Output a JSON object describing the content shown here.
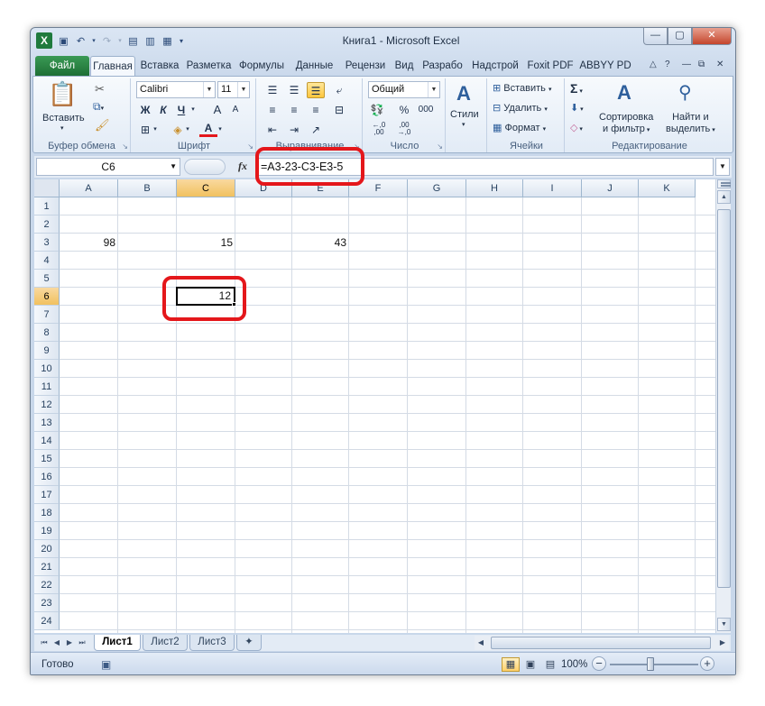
{
  "window": {
    "title": "Книга1  -  Microsoft Excel",
    "app_icon": "X",
    "controls": {
      "minimize": "—",
      "maximize": "▢",
      "close": "✕"
    }
  },
  "ribbon": {
    "tabs": [
      "Файл",
      "Главная",
      "Вставка",
      "Разметка",
      "Формулы",
      "Данные",
      "Рецензи",
      "Вид",
      "Разрабо",
      "Надстрой",
      "Foxit PDF",
      "ABBYY PD"
    ],
    "active_tab_index": 1,
    "groups": {
      "clipboard": {
        "label": "Буфер обмена",
        "paste": "Вставить"
      },
      "font": {
        "label": "Шрифт",
        "font_name": "Calibri",
        "font_size": "11",
        "bold": "Ж",
        "italic": "К",
        "underline": "Ч",
        "grow": "A",
        "shrink": "A",
        "color": "#e4171b"
      },
      "alignment": {
        "label": "Выравнивание"
      },
      "number": {
        "label": "Число",
        "format": "Общий",
        "percent": "%",
        "thousands": "000",
        "inc_dec": ",0\n,00",
        "dec_dec": ",00\n,0"
      },
      "styles": {
        "label": "Стили"
      },
      "cells": {
        "label": "Ячейки",
        "insert": "Вставить",
        "delete": "Удалить",
        "format": "Формат"
      },
      "editing": {
        "label": "Редактирование",
        "sum": "Σ",
        "sort": "Сортировка\nи фильтр",
        "sort_l1": "Сортировка",
        "sort_l2": "и фильтр",
        "find_l1": "Найти и",
        "find_l2": "выделить"
      }
    }
  },
  "formula_bar": {
    "name_box": "C6",
    "fx": "fx",
    "formula": "=A3-23-C3-E3-5"
  },
  "sheet": {
    "columns": [
      "A",
      "B",
      "C",
      "D",
      "E",
      "F",
      "G",
      "H",
      "I",
      "J",
      "K"
    ],
    "rows": [
      "1",
      "2",
      "3",
      "4",
      "5",
      "6",
      "7",
      "8",
      "9",
      "10",
      "11",
      "12",
      "13",
      "14",
      "15",
      "16",
      "17",
      "18",
      "19",
      "20",
      "21",
      "22",
      "23",
      "24"
    ],
    "selected_column": "C",
    "selected_row": "6",
    "cells": {
      "A3": "98",
      "C3": "15",
      "E3": "43",
      "C6": "12"
    }
  },
  "sheet_tabs": [
    "Лист1",
    "Лист2",
    "Лист3"
  ],
  "active_sheet_index": 0,
  "status": {
    "ready": "Готово",
    "zoom": "100%"
  },
  "colors": {
    "highlight": "#e4171b",
    "file_tab": "#1e6f35",
    "selected_header": "#f1c15f"
  }
}
